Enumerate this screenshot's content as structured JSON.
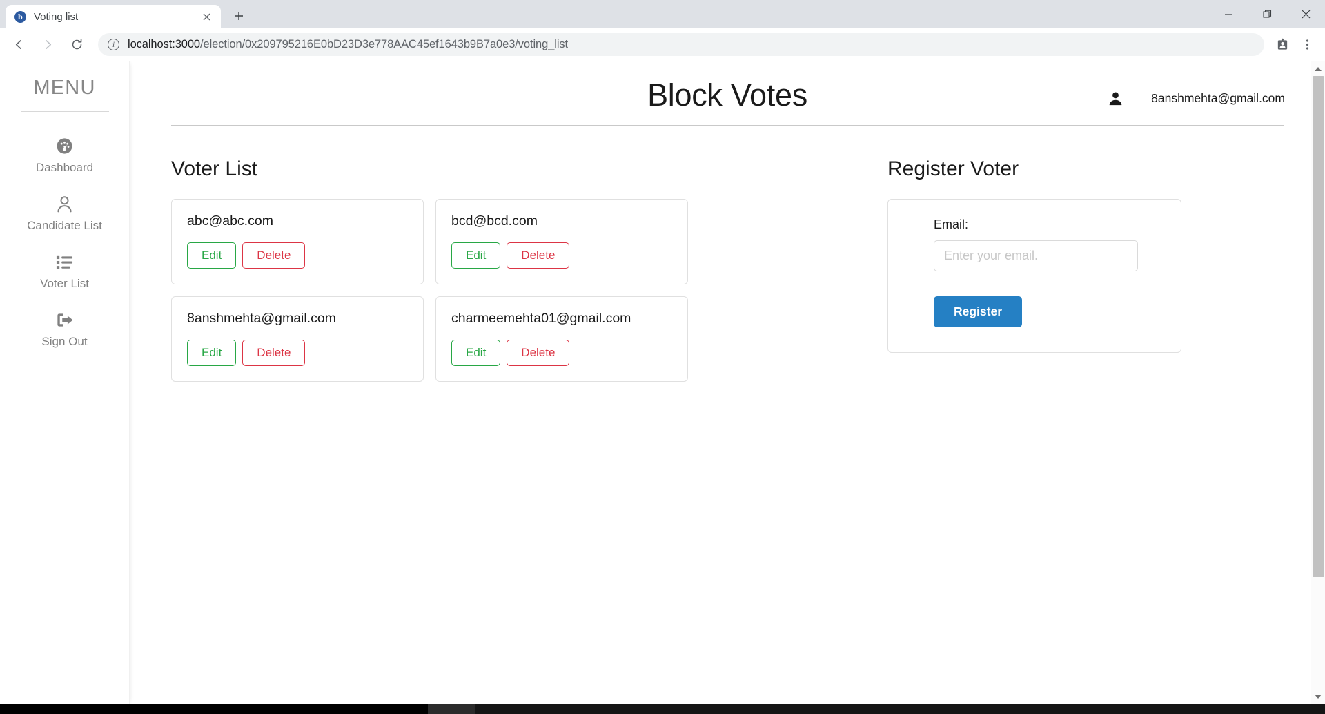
{
  "browser": {
    "tab": {
      "title": "Voting list",
      "favicon_letter": "b",
      "favicon_color": "#2c5aa0",
      "close_icon": "close-icon"
    },
    "new_tab_label": "+",
    "window_controls": {
      "minimize": "minimize-icon",
      "maximize": "restore-icon",
      "close": "close-icon"
    },
    "nav": {
      "back": "back-arrow-icon",
      "forward": "forward-arrow-icon",
      "reload": "reload-icon"
    },
    "omnibox": {
      "info_icon": "site-info-icon",
      "host": "localhost:3000",
      "path": "/election/0x209795216E0bD23D3e778AAC45ef1643b9B7a0e3/voting_list",
      "full_url": "localhost:3000/election/0x209795216E0bD23D3e778AAC45ef1643b9B7a0e3/voting_list"
    },
    "toolbar_icons": {
      "profile": "profile-card-icon",
      "menu": "three-dot-menu-icon"
    }
  },
  "sidebar": {
    "title": "MENU",
    "items": [
      {
        "label": "Dashboard",
        "icon": "dashboard-gauge-icon"
      },
      {
        "label": "Candidate List",
        "icon": "person-icon"
      },
      {
        "label": "Voter List",
        "icon": "list-icon"
      },
      {
        "label": "Sign Out",
        "icon": "sign-out-icon"
      }
    ]
  },
  "header": {
    "title": "Block Votes",
    "user_icon": "person-icon",
    "user_email": "8anshmehta@gmail.com"
  },
  "voter_list": {
    "title": "Voter List",
    "edit_label": "Edit",
    "delete_label": "Delete",
    "voters": [
      {
        "email": "abc@abc.com"
      },
      {
        "email": "bcd@bcd.com"
      },
      {
        "email": "8anshmehta@gmail.com"
      },
      {
        "email": "charmeemehta01@gmail.com"
      }
    ]
  },
  "register": {
    "title": "Register Voter",
    "email_label": "Email:",
    "email_value": "",
    "email_placeholder": "Enter your email.",
    "button_label": "Register",
    "button_color": "#2580c4"
  },
  "colors": {
    "edit_green": "#28a745",
    "delete_red": "#dc3545",
    "register_blue": "#2580c4",
    "sidebar_gray": "#808080"
  }
}
